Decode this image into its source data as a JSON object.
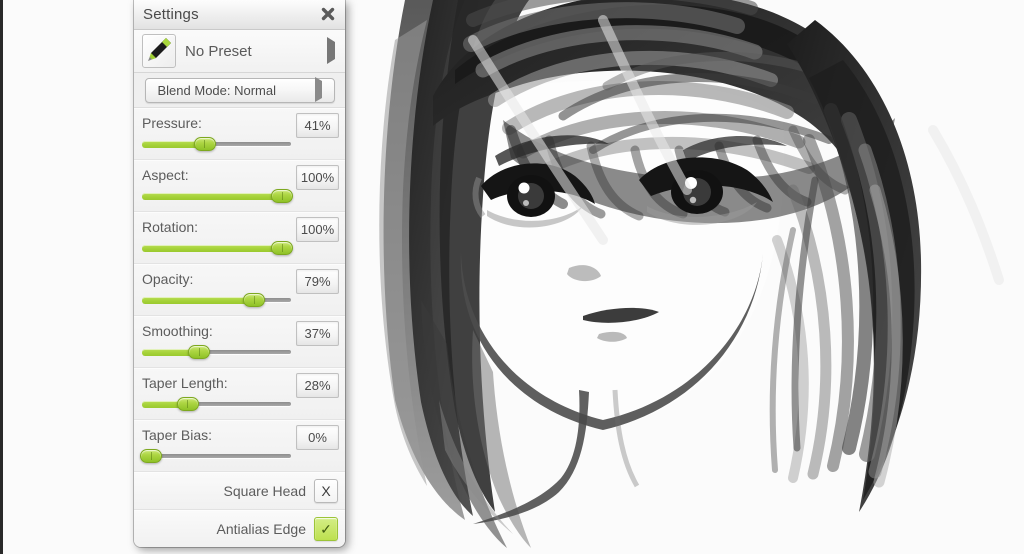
{
  "panel": {
    "title": "Settings",
    "close_icon": "close-x-icon",
    "preset": {
      "label": "No Preset",
      "icon": "marker-brush-icon",
      "arrow_icon": "triangle-right-icon"
    },
    "blend_mode": {
      "label": "Blend Mode: Normal",
      "arrow_icon": "triangle-right-icon"
    },
    "sliders": [
      {
        "label": "Pressure:",
        "value": "41%",
        "percent": 41
      },
      {
        "label": "Aspect:",
        "value": "100%",
        "percent": 100
      },
      {
        "label": "Rotation:",
        "value": "100%",
        "percent": 100
      },
      {
        "label": "Opacity:",
        "value": "79%",
        "percent": 79
      },
      {
        "label": "Smoothing:",
        "value": "37%",
        "percent": 37
      },
      {
        "label": "Taper Length:",
        "value": "28%",
        "percent": 28
      },
      {
        "label": "Taper Bias:",
        "value": "0%",
        "percent": 0
      }
    ],
    "toggles": [
      {
        "label": "Square Head",
        "glyph": "X",
        "state": "off"
      },
      {
        "label": "Antialias Edge",
        "glyph": "✓",
        "state": "on"
      }
    ]
  },
  "canvas": {
    "artwork_name": "grayscale-portrait-drawing"
  },
  "colors": {
    "accent_green": "#a5d238",
    "panel_bg": "#f2f2f2",
    "text": "#5c5c5c",
    "canvas_bg": "#fbfbfb"
  }
}
